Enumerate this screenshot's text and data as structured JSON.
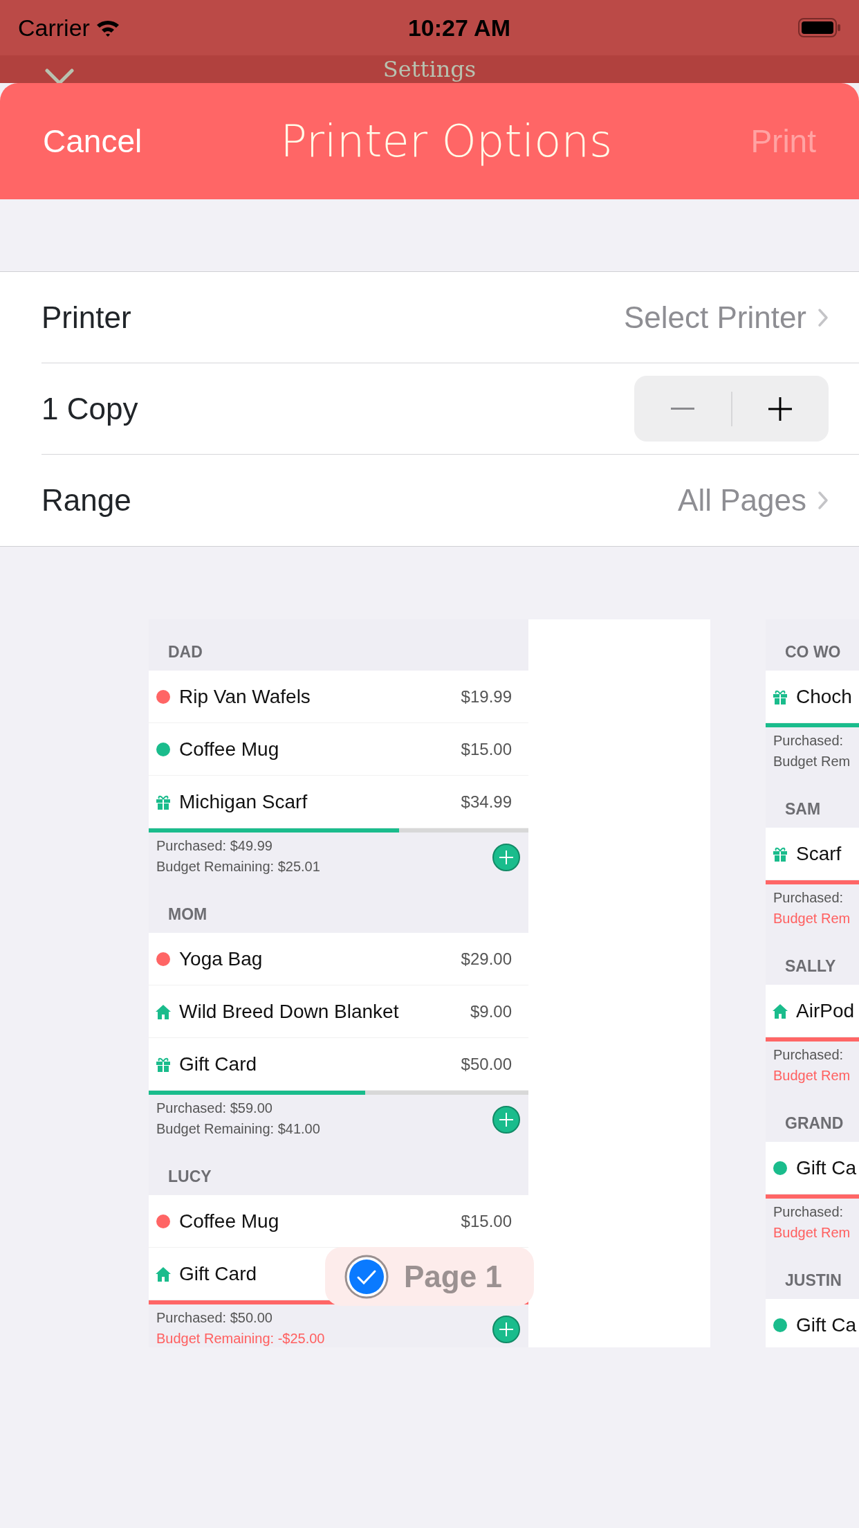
{
  "status_bar": {
    "carrier": "Carrier",
    "time": "10:27 AM"
  },
  "background_screen": {
    "title": "Settings"
  },
  "sheet": {
    "cancel": "Cancel",
    "title": "Printer Options",
    "print": {
      "label": "Print",
      "disabled": true
    }
  },
  "options": [
    {
      "kind": "link",
      "label": "Printer",
      "value": "Select Printer"
    },
    {
      "kind": "stepper",
      "label": "1 Copy"
    },
    {
      "kind": "link",
      "label": "Range",
      "value": "All Pages"
    }
  ],
  "pages": [
    {
      "badge": {
        "label": "Page 1",
        "checked": true
      },
      "sections": [
        {
          "name": "DAD",
          "items": [
            {
              "kind": "dot",
              "color": "#ff6565",
              "name": "Rip Van Wafels",
              "price": "$19.99"
            },
            {
              "kind": "dot",
              "color": "#1abc8c",
              "name": "Coffee Mug",
              "price": "$15.00"
            },
            {
              "kind": "gift",
              "name": "Michigan Scarf",
              "price": "$34.99"
            }
          ],
          "level": 0.66,
          "over_budget": false,
          "purchased": "Purchased: $49.99",
          "remaining": "Budget Remaining: $25.01",
          "add_button": true
        },
        {
          "name": "MOM",
          "items": [
            {
              "kind": "dot",
              "color": "#ff6565",
              "name": "Yoga Bag",
              "price": "$29.00"
            },
            {
              "kind": "home",
              "name": "Wild Breed Down Blanket",
              "price": "$9.00"
            },
            {
              "kind": "gift",
              "name": "Gift Card",
              "price": "$50.00"
            }
          ],
          "level": 0.57,
          "over_budget": false,
          "purchased": "Purchased: $59.00",
          "remaining": "Budget Remaining: $41.00",
          "add_button": true
        },
        {
          "name": "LUCY",
          "items": [
            {
              "kind": "dot",
              "color": "#ff6565",
              "name": "Coffee Mug",
              "price": "$15.00"
            },
            {
              "kind": "home",
              "name": "Gift Card"
            }
          ],
          "level": 1,
          "over_budget": true,
          "purchased": "Purchased: $50.00",
          "remaining": "Budget Remaining: -$25.00",
          "add_button": true
        }
      ]
    },
    {
      "sections": [
        {
          "name": "CO WO",
          "items": [
            {
              "kind": "gift",
              "name": "Choch"
            }
          ],
          "level": 1,
          "over_budget": false,
          "purchased": "Purchased:",
          "remaining": "Budget Rem"
        },
        {
          "name": "SAM",
          "items": [
            {
              "kind": "gift",
              "name": "Scarf"
            }
          ],
          "level": 1,
          "over_budget": true,
          "purchased": "Purchased:",
          "remaining": "Budget Rem"
        },
        {
          "name": "SALLY",
          "items": [
            {
              "kind": "home",
              "name": "AirPod"
            }
          ],
          "level": 1,
          "over_budget": true,
          "purchased": "Purchased:",
          "remaining": "Budget Rem"
        },
        {
          "name": "GRAND",
          "items": [
            {
              "kind": "dot",
              "color": "#1abc8c",
              "name": "Gift Ca"
            }
          ],
          "level": 1,
          "over_budget": true,
          "purchased": "Purchased:",
          "remaining": "Budget Rem"
        },
        {
          "name": "JUSTIN",
          "items": [
            {
              "kind": "dot",
              "color": "#1abc8c",
              "name": "Gift Ca"
            }
          ]
        }
      ]
    }
  ]
}
